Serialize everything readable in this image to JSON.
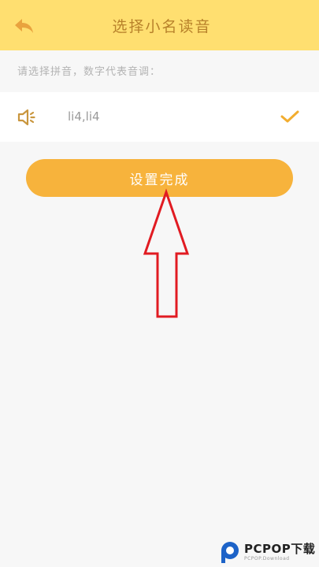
{
  "header": {
    "title": "选择小名读音",
    "back_icon": "back-arrow-icon",
    "background": "#ffdf70"
  },
  "prompt": "请选择拼音，数字代表音调：",
  "options": [
    {
      "pinyin": "li4,li4",
      "selected": true,
      "speaker_icon": "speaker-icon",
      "check_icon": "checkmark-icon"
    }
  ],
  "done_button": {
    "label": "设置完成",
    "color": "#f7b33c"
  },
  "annotation": {
    "icon": "red-up-arrow-icon",
    "color": "#e11b22"
  },
  "watermark": {
    "brand": "PCPOP下载",
    "sub": "PCPOP.Download"
  }
}
